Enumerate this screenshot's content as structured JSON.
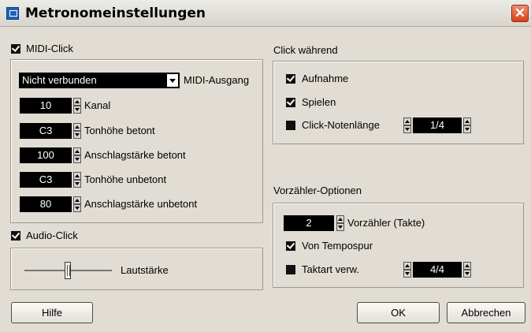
{
  "window": {
    "title": "Metronomeinstellungen",
    "close_glyph": "✕"
  },
  "midi_click": {
    "label": "MIDI-Click",
    "checked": true,
    "output": {
      "value": "Nicht verbunden",
      "label": "MIDI-Ausgang"
    },
    "fields": [
      {
        "value": "10",
        "label": "Kanal"
      },
      {
        "value": "C3",
        "label": "Tonhöhe betont"
      },
      {
        "value": "100",
        "label": "Anschlagstärke betont"
      },
      {
        "value": "C3",
        "label": "Tonhöhe unbetont"
      },
      {
        "value": "80",
        "label": "Anschlagstärke unbetont"
      }
    ]
  },
  "audio_click": {
    "label": "Audio-Click",
    "checked": true,
    "volume_label": "Lautstärke"
  },
  "click_during": {
    "heading": "Click während",
    "options": [
      {
        "label": "Aufnahme",
        "checked": true
      },
      {
        "label": "Spielen",
        "checked": true
      },
      {
        "label": "Click-Notenlänge",
        "checked": false,
        "value": "1/4"
      }
    ]
  },
  "count_in": {
    "heading": "Vorzähler-Optionen",
    "bars": {
      "value": "2",
      "label": "Vorzähler (Takte)"
    },
    "from_tempo": {
      "label": "Von Tempospur",
      "checked": true
    },
    "time_sig": {
      "label": "Taktart verw.",
      "checked": false,
      "value": "4/4"
    }
  },
  "buttons": {
    "help": "Hilfe",
    "ok": "OK",
    "cancel": "Abbrechen"
  },
  "colors": {
    "accent_close": "#d8431f",
    "field_bg": "#000000",
    "window_bg": "#e1ddd4"
  }
}
